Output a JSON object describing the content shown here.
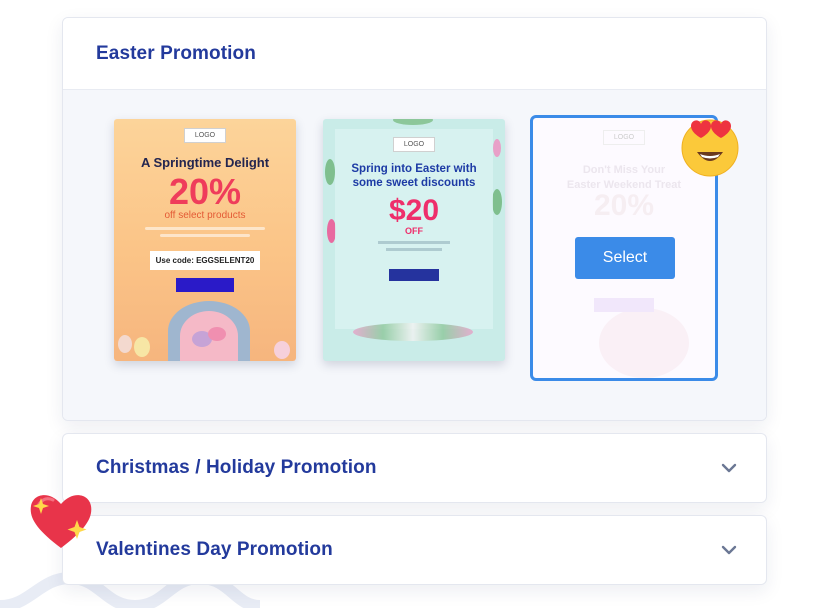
{
  "sections": [
    {
      "title": "Easter Promotion",
      "expanded": true,
      "templates": [
        {
          "logo": "LOGO",
          "headline": "A Springtime Delight",
          "offer": "20%",
          "offer_sub": "off select products",
          "code": "Use code: EGGSELENT20"
        },
        {
          "logo": "LOGO",
          "headline_line1": "Spring into Easter with",
          "headline_line2": "some sweet discounts",
          "offer": "$20",
          "offer_sub": "OFF"
        },
        {
          "logo": "LOGO",
          "headline_line1": "Don't Miss Your",
          "headline_line2": "Easter Weekend Treat",
          "offer": "20%",
          "select_label": "Select",
          "selected": true
        }
      ]
    },
    {
      "title": "Christmas / Holiday Promotion",
      "expanded": false
    },
    {
      "title": "Valentines Day Promotion",
      "expanded": false
    }
  ],
  "colors": {
    "title": "#233a9c",
    "accent": "#3b8be8",
    "chevron": "#6b7794"
  },
  "icons": {
    "section_toggle": "chevron-down-icon",
    "decoration_top": "heart-eyes-emoji-icon",
    "decoration_bottom": "sparkling-heart-icon"
  }
}
